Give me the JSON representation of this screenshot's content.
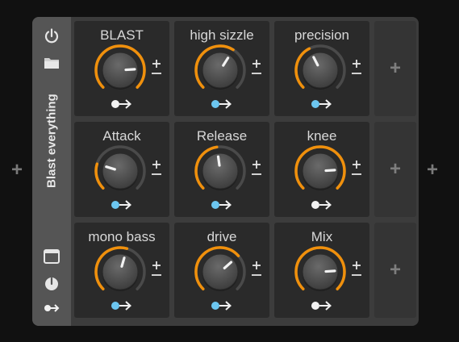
{
  "device": {
    "title": "Blast everything",
    "icons": {
      "power": "power-icon",
      "folder": "folder-icon",
      "window": "window-icon",
      "dial": "dial-icon",
      "modulation": "modulation-source-icon"
    }
  },
  "outer_add": "+",
  "add_slot": "+",
  "plus_minus": "±",
  "colors": {
    "accent": "#f0900c",
    "mod_active": "#6cc6f0",
    "mod_inactive": "#f2f2f2"
  },
  "macros": [
    {
      "label": "BLAST",
      "arc_fraction": 1.0,
      "pointer_fraction": 0.82,
      "mod_active": false
    },
    {
      "label": "high sizzle",
      "arc_fraction": 0.62,
      "pointer_fraction": 0.62,
      "mod_active": true
    },
    {
      "label": "precision",
      "arc_fraction": 0.4,
      "pointer_fraction": 0.4,
      "mod_active": true
    },
    {
      "label": "Attack",
      "arc_fraction": 0.23,
      "pointer_fraction": 0.23,
      "mod_active": true
    },
    {
      "label": "Release",
      "arc_fraction": 0.47,
      "pointer_fraction": 0.47,
      "mod_active": true
    },
    {
      "label": "knee",
      "arc_fraction": 1.0,
      "pointer_fraction": 0.82,
      "mod_active": false
    },
    {
      "label": "mono bass",
      "arc_fraction": 0.56,
      "pointer_fraction": 0.56,
      "mod_active": true
    },
    {
      "label": "drive",
      "arc_fraction": 0.68,
      "pointer_fraction": 0.68,
      "mod_active": true
    },
    {
      "label": "Mix",
      "arc_fraction": 1.0,
      "pointer_fraction": 0.82,
      "mod_active": false
    }
  ]
}
